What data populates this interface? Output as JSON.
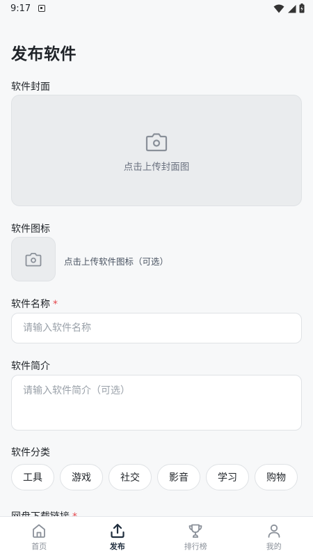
{
  "status_bar": {
    "time": "9:17"
  },
  "page": {
    "title": "发布软件"
  },
  "cover": {
    "label": "软件封面",
    "hint": "点击上传封面图"
  },
  "icon": {
    "label": "软件图标",
    "hint": "点击上传软件图标（可选）"
  },
  "name": {
    "label": "软件名称",
    "required_mark": "*",
    "placeholder": "请输入软件名称"
  },
  "intro": {
    "label": "软件简介",
    "placeholder": "请输入软件简介（可选）"
  },
  "category": {
    "label": "软件分类",
    "options": [
      "工具",
      "游戏",
      "社交",
      "影音",
      "学习",
      "购物"
    ]
  },
  "download": {
    "label": "网盘下载链接",
    "required_mark": "*"
  },
  "nav": {
    "items": [
      {
        "label": "首页",
        "icon": "home-icon"
      },
      {
        "label": "发布",
        "icon": "upload-icon",
        "active": true
      },
      {
        "label": "排行榜",
        "icon": "trophy-icon"
      },
      {
        "label": "我的",
        "icon": "user-icon"
      }
    ]
  },
  "colors": {
    "accent": "#1f2d3d",
    "required": "#e5484d",
    "muted": "#8a9099"
  }
}
